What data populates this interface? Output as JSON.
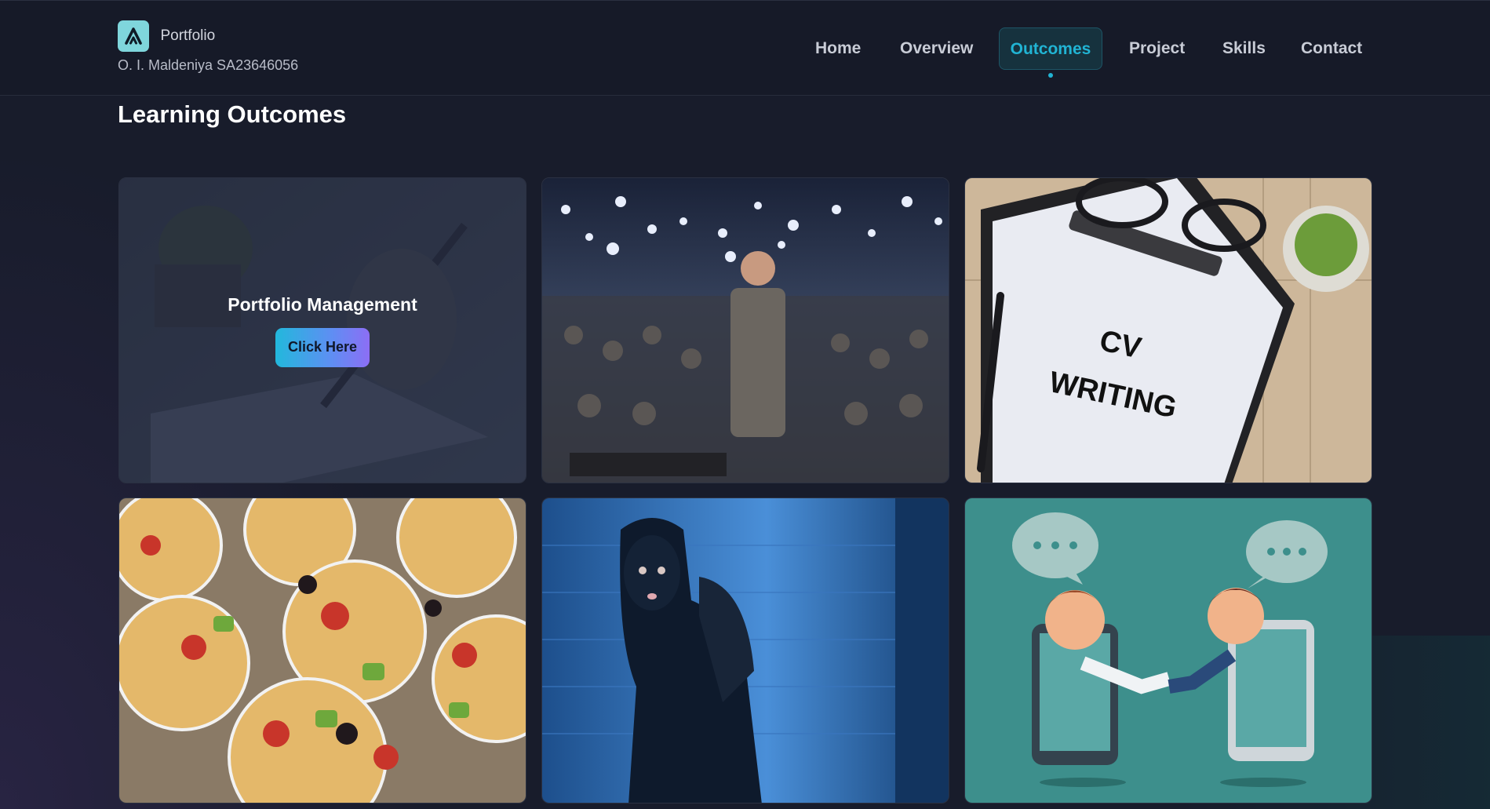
{
  "header": {
    "brand_name": "Portfolio",
    "author": "O. I. Maldeniya SA23646056",
    "nav": [
      {
        "label": "Home",
        "active": false
      },
      {
        "label": "Overview",
        "active": false
      },
      {
        "label": "Outcomes",
        "active": true
      },
      {
        "label": "Project",
        "active": false
      },
      {
        "label": "Skills",
        "active": false
      },
      {
        "label": "Contact",
        "active": false
      }
    ]
  },
  "main": {
    "title": "Learning Outcomes",
    "cards": [
      {
        "overlay_title": "Portfolio Management",
        "button_label": "Click Here"
      },
      {
        "image_text": ""
      },
      {
        "image_text_line1": "CV",
        "image_text_line2": "WRITING"
      },
      {
        "image_text": ""
      },
      {
        "image_text": ""
      },
      {
        "image_text": "..."
      }
    ]
  },
  "colors": {
    "accent": "#21b4d4",
    "background": "#181c2b",
    "header": "#161a28",
    "logo": "#7fd6dc"
  },
  "icons": [
    "logo-icon",
    "chevron-up-icon"
  ]
}
